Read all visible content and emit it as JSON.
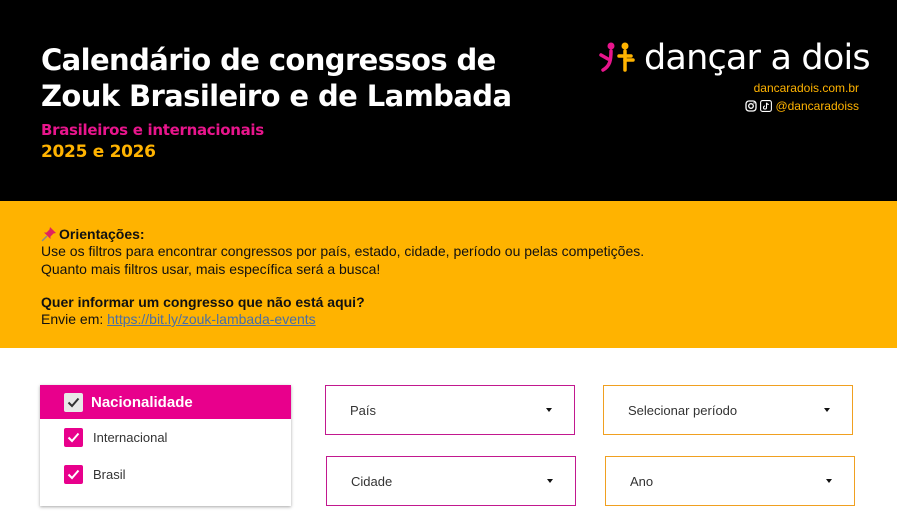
{
  "header": {
    "title": "Calendário de congressos de Zouk Brasileiro e de Lambada",
    "subtitle": "Brasileiros e internacionais",
    "years": "2025 e 2026",
    "logo_text": "dançar a dois",
    "website": "dancaradois.com.br",
    "social_handle": "@dancaradoiss",
    "colors": {
      "background": "#000000",
      "title": "#ffffff",
      "pink": "#e8158c",
      "orange": "#ffb300"
    }
  },
  "guidelines": {
    "heading": "Orientações:",
    "line1": "Use os filtros para encontrar congressos por país, estado, cidade, período ou pelas competições.",
    "line2": "Quanto mais filtros usar, mais específica será a busca!",
    "question": "Quer informar um congresso que não está aqui?",
    "send_prefix": "Envie em:",
    "link": "https://bit.ly/zouk-lambada-events",
    "icon": "pushpin-icon",
    "background": "#ffb300"
  },
  "filters": {
    "nationality": {
      "label": "Nacionalidade",
      "options": [
        {
          "label": "Internacional",
          "checked": true
        },
        {
          "label": "Brasil",
          "checked": true
        }
      ]
    },
    "country": {
      "value": "País"
    },
    "city": {
      "value": "Cidade"
    },
    "period": {
      "value": "Selecionar período"
    },
    "year": {
      "value": "Ano"
    }
  }
}
